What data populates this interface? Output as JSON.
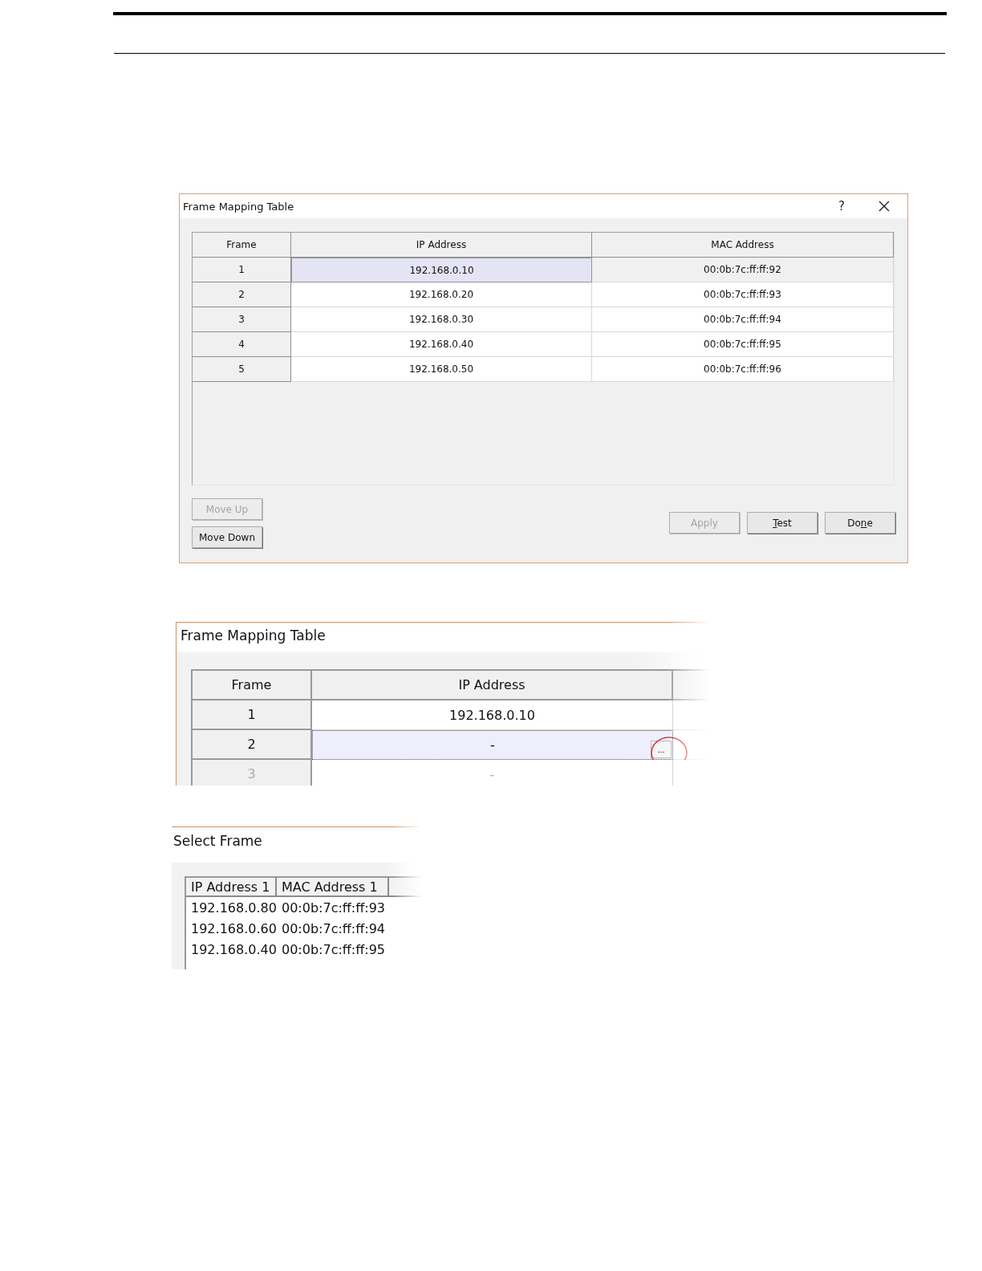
{
  "main_dialog": {
    "title": "Frame Mapping Table",
    "help": "?",
    "columns": [
      "Frame",
      "IP Address",
      "MAC Address"
    ],
    "rows": [
      {
        "frame": "1",
        "ip": "192.168.0.10",
        "mac": "00:0b:7c:ff:ff:92",
        "selected": true
      },
      {
        "frame": "2",
        "ip": "192.168.0.20",
        "mac": "00:0b:7c:ff:ff:93",
        "selected": false
      },
      {
        "frame": "3",
        "ip": "192.168.0.30",
        "mac": "00:0b:7c:ff:ff:94",
        "selected": false
      },
      {
        "frame": "4",
        "ip": "192.168.0.40",
        "mac": "00:0b:7c:ff:ff:95",
        "selected": false
      },
      {
        "frame": "5",
        "ip": "192.168.0.50",
        "mac": "00:0b:7c:ff:ff:96",
        "selected": false
      }
    ],
    "left_buttons": [
      {
        "label": "Move Up",
        "disabled": true
      },
      {
        "label": "Move Down",
        "disabled": false
      }
    ],
    "right_buttons": [
      {
        "label": "Apply",
        "disabled": true
      },
      {
        "mnemonic": "T",
        "label_after": "est",
        "disabled": false
      },
      {
        "label_before": "Do",
        "mnemonic": "n",
        "label_after": "e",
        "disabled": false
      }
    ]
  },
  "detail_dialog": {
    "title": "Frame Mapping Table",
    "columns": [
      "Frame",
      "IP Address"
    ],
    "rows": [
      {
        "frame": "1",
        "ip": "192.168.0.10",
        "selected": false,
        "disabled": false
      },
      {
        "frame": "2",
        "ip": "-",
        "selected": true,
        "disabled": false,
        "browse": "..."
      },
      {
        "frame": "3",
        "ip": "-",
        "selected": false,
        "disabled": true
      }
    ]
  },
  "select_dialog": {
    "title": "Select Frame",
    "columns": [
      "IP Address 1",
      "MAC Address 1"
    ],
    "rows": [
      {
        "ip": "192.168.0.80",
        "mac": "00:0b:7c:ff:ff:93"
      },
      {
        "ip": "192.168.0.60",
        "mac": "00:0b:7c:ff:ff:94"
      },
      {
        "ip": "192.168.0.40",
        "mac": "00:0b:7c:ff:ff:95"
      }
    ]
  }
}
